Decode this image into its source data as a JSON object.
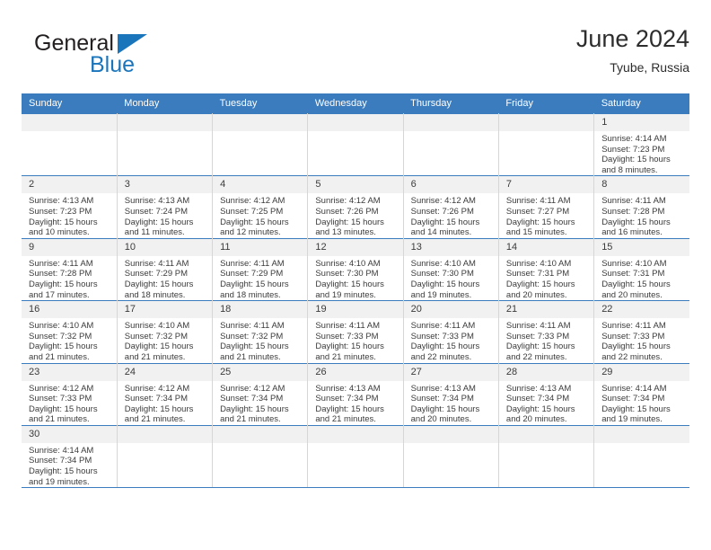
{
  "logo": {
    "word_top": "General",
    "word_bottom": "Blue",
    "triangle_color": "#1b75bb",
    "text_color": "#231f20",
    "icon": "triangle-icon"
  },
  "header": {
    "title": "June 2024",
    "subtitle": "Tyube, Russia"
  },
  "theme": {
    "header_bg": "#3a7cbe",
    "header_text": "#ffffff",
    "daynum_bg": "#f1f1f1",
    "grid_line": "#3a7cbe",
    "cell_divider": "#d6d6d6"
  },
  "weekday_headers": [
    "Sunday",
    "Monday",
    "Tuesday",
    "Wednesday",
    "Thursday",
    "Friday",
    "Saturday"
  ],
  "labels": {
    "sunrise_prefix": "Sunrise:",
    "sunset_prefix": "Sunset:",
    "daylight_prefix": "Daylight:"
  },
  "weeks": [
    [
      {
        "empty": true
      },
      {
        "empty": true
      },
      {
        "empty": true
      },
      {
        "empty": true
      },
      {
        "empty": true
      },
      {
        "empty": true
      },
      {
        "day": "1",
        "sunrise": "Sunrise: 4:14 AM",
        "sunset": "Sunset: 7:23 PM",
        "daylight_line1": "Daylight: 15 hours",
        "daylight_line2": "and 8 minutes."
      }
    ],
    [
      {
        "day": "2",
        "sunrise": "Sunrise: 4:13 AM",
        "sunset": "Sunset: 7:23 PM",
        "daylight_line1": "Daylight: 15 hours",
        "daylight_line2": "and 10 minutes."
      },
      {
        "day": "3",
        "sunrise": "Sunrise: 4:13 AM",
        "sunset": "Sunset: 7:24 PM",
        "daylight_line1": "Daylight: 15 hours",
        "daylight_line2": "and 11 minutes."
      },
      {
        "day": "4",
        "sunrise": "Sunrise: 4:12 AM",
        "sunset": "Sunset: 7:25 PM",
        "daylight_line1": "Daylight: 15 hours",
        "daylight_line2": "and 12 minutes."
      },
      {
        "day": "5",
        "sunrise": "Sunrise: 4:12 AM",
        "sunset": "Sunset: 7:26 PM",
        "daylight_line1": "Daylight: 15 hours",
        "daylight_line2": "and 13 minutes."
      },
      {
        "day": "6",
        "sunrise": "Sunrise: 4:12 AM",
        "sunset": "Sunset: 7:26 PM",
        "daylight_line1": "Daylight: 15 hours",
        "daylight_line2": "and 14 minutes."
      },
      {
        "day": "7",
        "sunrise": "Sunrise: 4:11 AM",
        "sunset": "Sunset: 7:27 PM",
        "daylight_line1": "Daylight: 15 hours",
        "daylight_line2": "and 15 minutes."
      },
      {
        "day": "8",
        "sunrise": "Sunrise: 4:11 AM",
        "sunset": "Sunset: 7:28 PM",
        "daylight_line1": "Daylight: 15 hours",
        "daylight_line2": "and 16 minutes."
      }
    ],
    [
      {
        "day": "9",
        "sunrise": "Sunrise: 4:11 AM",
        "sunset": "Sunset: 7:28 PM",
        "daylight_line1": "Daylight: 15 hours",
        "daylight_line2": "and 17 minutes."
      },
      {
        "day": "10",
        "sunrise": "Sunrise: 4:11 AM",
        "sunset": "Sunset: 7:29 PM",
        "daylight_line1": "Daylight: 15 hours",
        "daylight_line2": "and 18 minutes."
      },
      {
        "day": "11",
        "sunrise": "Sunrise: 4:11 AM",
        "sunset": "Sunset: 7:29 PM",
        "daylight_line1": "Daylight: 15 hours",
        "daylight_line2": "and 18 minutes."
      },
      {
        "day": "12",
        "sunrise": "Sunrise: 4:10 AM",
        "sunset": "Sunset: 7:30 PM",
        "daylight_line1": "Daylight: 15 hours",
        "daylight_line2": "and 19 minutes."
      },
      {
        "day": "13",
        "sunrise": "Sunrise: 4:10 AM",
        "sunset": "Sunset: 7:30 PM",
        "daylight_line1": "Daylight: 15 hours",
        "daylight_line2": "and 19 minutes."
      },
      {
        "day": "14",
        "sunrise": "Sunrise: 4:10 AM",
        "sunset": "Sunset: 7:31 PM",
        "daylight_line1": "Daylight: 15 hours",
        "daylight_line2": "and 20 minutes."
      },
      {
        "day": "15",
        "sunrise": "Sunrise: 4:10 AM",
        "sunset": "Sunset: 7:31 PM",
        "daylight_line1": "Daylight: 15 hours",
        "daylight_line2": "and 20 minutes."
      }
    ],
    [
      {
        "day": "16",
        "sunrise": "Sunrise: 4:10 AM",
        "sunset": "Sunset: 7:32 PM",
        "daylight_line1": "Daylight: 15 hours",
        "daylight_line2": "and 21 minutes."
      },
      {
        "day": "17",
        "sunrise": "Sunrise: 4:10 AM",
        "sunset": "Sunset: 7:32 PM",
        "daylight_line1": "Daylight: 15 hours",
        "daylight_line2": "and 21 minutes."
      },
      {
        "day": "18",
        "sunrise": "Sunrise: 4:11 AM",
        "sunset": "Sunset: 7:32 PM",
        "daylight_line1": "Daylight: 15 hours",
        "daylight_line2": "and 21 minutes."
      },
      {
        "day": "19",
        "sunrise": "Sunrise: 4:11 AM",
        "sunset": "Sunset: 7:33 PM",
        "daylight_line1": "Daylight: 15 hours",
        "daylight_line2": "and 21 minutes."
      },
      {
        "day": "20",
        "sunrise": "Sunrise: 4:11 AM",
        "sunset": "Sunset: 7:33 PM",
        "daylight_line1": "Daylight: 15 hours",
        "daylight_line2": "and 22 minutes."
      },
      {
        "day": "21",
        "sunrise": "Sunrise: 4:11 AM",
        "sunset": "Sunset: 7:33 PM",
        "daylight_line1": "Daylight: 15 hours",
        "daylight_line2": "and 22 minutes."
      },
      {
        "day": "22",
        "sunrise": "Sunrise: 4:11 AM",
        "sunset": "Sunset: 7:33 PM",
        "daylight_line1": "Daylight: 15 hours",
        "daylight_line2": "and 22 minutes."
      }
    ],
    [
      {
        "day": "23",
        "sunrise": "Sunrise: 4:12 AM",
        "sunset": "Sunset: 7:33 PM",
        "daylight_line1": "Daylight: 15 hours",
        "daylight_line2": "and 21 minutes."
      },
      {
        "day": "24",
        "sunrise": "Sunrise: 4:12 AM",
        "sunset": "Sunset: 7:34 PM",
        "daylight_line1": "Daylight: 15 hours",
        "daylight_line2": "and 21 minutes."
      },
      {
        "day": "25",
        "sunrise": "Sunrise: 4:12 AM",
        "sunset": "Sunset: 7:34 PM",
        "daylight_line1": "Daylight: 15 hours",
        "daylight_line2": "and 21 minutes."
      },
      {
        "day": "26",
        "sunrise": "Sunrise: 4:13 AM",
        "sunset": "Sunset: 7:34 PM",
        "daylight_line1": "Daylight: 15 hours",
        "daylight_line2": "and 21 minutes."
      },
      {
        "day": "27",
        "sunrise": "Sunrise: 4:13 AM",
        "sunset": "Sunset: 7:34 PM",
        "daylight_line1": "Daylight: 15 hours",
        "daylight_line2": "and 20 minutes."
      },
      {
        "day": "28",
        "sunrise": "Sunrise: 4:13 AM",
        "sunset": "Sunset: 7:34 PM",
        "daylight_line1": "Daylight: 15 hours",
        "daylight_line2": "and 20 minutes."
      },
      {
        "day": "29",
        "sunrise": "Sunrise: 4:14 AM",
        "sunset": "Sunset: 7:34 PM",
        "daylight_line1": "Daylight: 15 hours",
        "daylight_line2": "and 19 minutes."
      }
    ],
    [
      {
        "day": "30",
        "sunrise": "Sunrise: 4:14 AM",
        "sunset": "Sunset: 7:34 PM",
        "daylight_line1": "Daylight: 15 hours",
        "daylight_line2": "and 19 minutes."
      },
      {
        "empty": true
      },
      {
        "empty": true
      },
      {
        "empty": true
      },
      {
        "empty": true
      },
      {
        "empty": true
      },
      {
        "empty": true
      }
    ]
  ]
}
